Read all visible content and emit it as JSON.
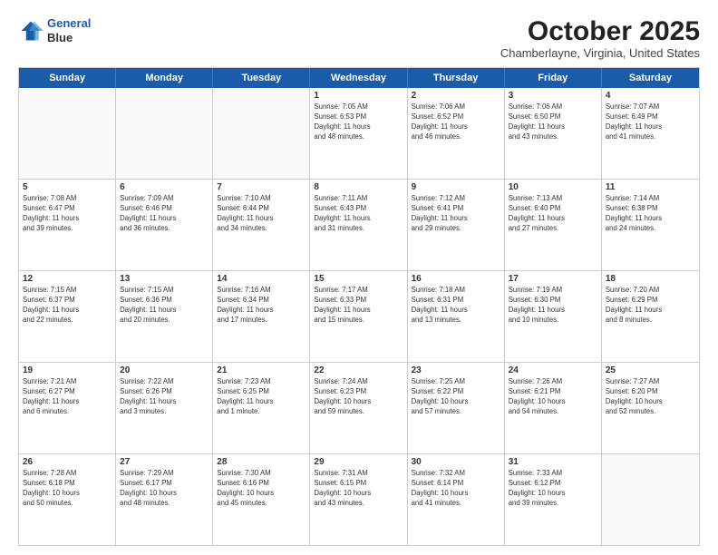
{
  "header": {
    "logo_line1": "General",
    "logo_line2": "Blue",
    "month": "October 2025",
    "location": "Chamberlayne, Virginia, United States"
  },
  "days_of_week": [
    "Sunday",
    "Monday",
    "Tuesday",
    "Wednesday",
    "Thursday",
    "Friday",
    "Saturday"
  ],
  "weeks": [
    [
      {
        "day": "",
        "info": "",
        "empty": true
      },
      {
        "day": "",
        "info": "",
        "empty": true
      },
      {
        "day": "",
        "info": "",
        "empty": true
      },
      {
        "day": "1",
        "info": "Sunrise: 7:05 AM\nSunset: 6:53 PM\nDaylight: 11 hours\nand 48 minutes.",
        "empty": false
      },
      {
        "day": "2",
        "info": "Sunrise: 7:06 AM\nSunset: 6:52 PM\nDaylight: 11 hours\nand 46 minutes.",
        "empty": false
      },
      {
        "day": "3",
        "info": "Sunrise: 7:06 AM\nSunset: 6:50 PM\nDaylight: 11 hours\nand 43 minutes.",
        "empty": false
      },
      {
        "day": "4",
        "info": "Sunrise: 7:07 AM\nSunset: 6:49 PM\nDaylight: 11 hours\nand 41 minutes.",
        "empty": false
      }
    ],
    [
      {
        "day": "5",
        "info": "Sunrise: 7:08 AM\nSunset: 6:47 PM\nDaylight: 11 hours\nand 39 minutes.",
        "empty": false
      },
      {
        "day": "6",
        "info": "Sunrise: 7:09 AM\nSunset: 6:46 PM\nDaylight: 11 hours\nand 36 minutes.",
        "empty": false
      },
      {
        "day": "7",
        "info": "Sunrise: 7:10 AM\nSunset: 6:44 PM\nDaylight: 11 hours\nand 34 minutes.",
        "empty": false
      },
      {
        "day": "8",
        "info": "Sunrise: 7:11 AM\nSunset: 6:43 PM\nDaylight: 11 hours\nand 31 minutes.",
        "empty": false
      },
      {
        "day": "9",
        "info": "Sunrise: 7:12 AM\nSunset: 6:41 PM\nDaylight: 11 hours\nand 29 minutes.",
        "empty": false
      },
      {
        "day": "10",
        "info": "Sunrise: 7:13 AM\nSunset: 6:40 PM\nDaylight: 11 hours\nand 27 minutes.",
        "empty": false
      },
      {
        "day": "11",
        "info": "Sunrise: 7:14 AM\nSunset: 6:38 PM\nDaylight: 11 hours\nand 24 minutes.",
        "empty": false
      }
    ],
    [
      {
        "day": "12",
        "info": "Sunrise: 7:15 AM\nSunset: 6:37 PM\nDaylight: 11 hours\nand 22 minutes.",
        "empty": false
      },
      {
        "day": "13",
        "info": "Sunrise: 7:15 AM\nSunset: 6:36 PM\nDaylight: 11 hours\nand 20 minutes.",
        "empty": false
      },
      {
        "day": "14",
        "info": "Sunrise: 7:16 AM\nSunset: 6:34 PM\nDaylight: 11 hours\nand 17 minutes.",
        "empty": false
      },
      {
        "day": "15",
        "info": "Sunrise: 7:17 AM\nSunset: 6:33 PM\nDaylight: 11 hours\nand 15 minutes.",
        "empty": false
      },
      {
        "day": "16",
        "info": "Sunrise: 7:18 AM\nSunset: 6:31 PM\nDaylight: 11 hours\nand 13 minutes.",
        "empty": false
      },
      {
        "day": "17",
        "info": "Sunrise: 7:19 AM\nSunset: 6:30 PM\nDaylight: 11 hours\nand 10 minutes.",
        "empty": false
      },
      {
        "day": "18",
        "info": "Sunrise: 7:20 AM\nSunset: 6:29 PM\nDaylight: 11 hours\nand 8 minutes.",
        "empty": false
      }
    ],
    [
      {
        "day": "19",
        "info": "Sunrise: 7:21 AM\nSunset: 6:27 PM\nDaylight: 11 hours\nand 6 minutes.",
        "empty": false
      },
      {
        "day": "20",
        "info": "Sunrise: 7:22 AM\nSunset: 6:26 PM\nDaylight: 11 hours\nand 3 minutes.",
        "empty": false
      },
      {
        "day": "21",
        "info": "Sunrise: 7:23 AM\nSunset: 6:25 PM\nDaylight: 11 hours\nand 1 minute.",
        "empty": false
      },
      {
        "day": "22",
        "info": "Sunrise: 7:24 AM\nSunset: 6:23 PM\nDaylight: 10 hours\nand 59 minutes.",
        "empty": false
      },
      {
        "day": "23",
        "info": "Sunrise: 7:25 AM\nSunset: 6:22 PM\nDaylight: 10 hours\nand 57 minutes.",
        "empty": false
      },
      {
        "day": "24",
        "info": "Sunrise: 7:26 AM\nSunset: 6:21 PM\nDaylight: 10 hours\nand 54 minutes.",
        "empty": false
      },
      {
        "day": "25",
        "info": "Sunrise: 7:27 AM\nSunset: 6:20 PM\nDaylight: 10 hours\nand 52 minutes.",
        "empty": false
      }
    ],
    [
      {
        "day": "26",
        "info": "Sunrise: 7:28 AM\nSunset: 6:18 PM\nDaylight: 10 hours\nand 50 minutes.",
        "empty": false
      },
      {
        "day": "27",
        "info": "Sunrise: 7:29 AM\nSunset: 6:17 PM\nDaylight: 10 hours\nand 48 minutes.",
        "empty": false
      },
      {
        "day": "28",
        "info": "Sunrise: 7:30 AM\nSunset: 6:16 PM\nDaylight: 10 hours\nand 45 minutes.",
        "empty": false
      },
      {
        "day": "29",
        "info": "Sunrise: 7:31 AM\nSunset: 6:15 PM\nDaylight: 10 hours\nand 43 minutes.",
        "empty": false
      },
      {
        "day": "30",
        "info": "Sunrise: 7:32 AM\nSunset: 6:14 PM\nDaylight: 10 hours\nand 41 minutes.",
        "empty": false
      },
      {
        "day": "31",
        "info": "Sunrise: 7:33 AM\nSunset: 6:12 PM\nDaylight: 10 hours\nand 39 minutes.",
        "empty": false
      },
      {
        "day": "",
        "info": "",
        "empty": true
      }
    ]
  ]
}
